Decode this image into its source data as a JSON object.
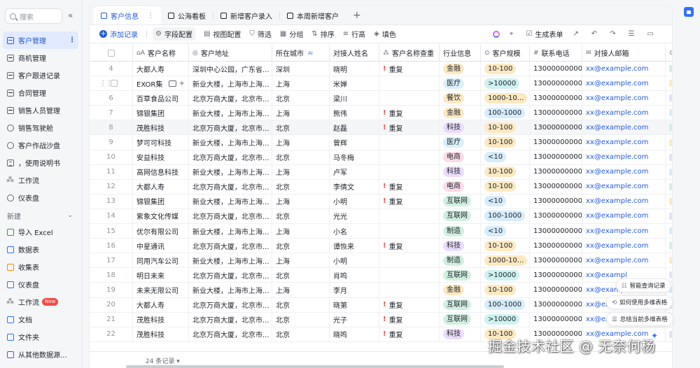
{
  "sidebar": {
    "search_placeholder": "搜索",
    "collapse_icon": "«",
    "items": [
      {
        "label": "客户管理",
        "icon": "grid",
        "active": true
      },
      {
        "label": "商机管理",
        "icon": "grid"
      },
      {
        "label": "客户跟进记录",
        "icon": "grid"
      },
      {
        "label": "合同管理",
        "icon": "grid"
      },
      {
        "label": "销售人员管理",
        "icon": "grid"
      },
      {
        "label": "销售驾驶舱",
        "icon": "gauge"
      },
      {
        "label": "客户作战沙盘",
        "icon": "gauge"
      },
      {
        "label": "，使用说明书",
        "icon": "doc"
      },
      {
        "label": "工作流",
        "icon": "flow"
      },
      {
        "label": "仪表盘",
        "icon": "gauge"
      }
    ],
    "section_title": "新建",
    "new_items": [
      {
        "label": "导入 Excel",
        "icon": "green"
      },
      {
        "label": "数据表",
        "icon": "blue"
      },
      {
        "label": "收集表",
        "icon": "orange"
      },
      {
        "label": "仪表盘",
        "icon": "blue"
      },
      {
        "label": "工作流",
        "icon": "flow",
        "badge": "New"
      },
      {
        "label": "文档",
        "icon": "blue"
      },
      {
        "label": "文件夹",
        "icon": "blue"
      },
      {
        "label": "从其他数据源...",
        "icon": "purple"
      }
    ]
  },
  "tabs": [
    {
      "label": "客户信息",
      "active": true,
      "more": "⋮"
    },
    {
      "label": "公海看板"
    },
    {
      "label": "新增客户录入"
    },
    {
      "label": "本周新增客户"
    }
  ],
  "tab_add": "+",
  "toolbar": {
    "add_record": "添加记录",
    "field_config": "字段配置",
    "view_config": "视图配置",
    "filter": "筛选",
    "group": "分组",
    "sort": "排序",
    "row_height": "行高",
    "fill": "填色",
    "generate_form": "生成表单"
  },
  "columns": {
    "name": "客户名称",
    "address": "客户地址",
    "city": "所在城市",
    "city_ai": "AI",
    "contact": "对接人姓名",
    "dup_check": "客户名称查重",
    "industry": "行业信息",
    "scale": "客户规模",
    "phone": "联系电话",
    "email": "对接人邮箱"
  },
  "hover_row_name": "EXOR集",
  "rows": [
    {
      "idx": "4",
      "name": "大都人寿",
      "addr": "深圳中心公园，广东省...",
      "city": "深圳",
      "contact": "晓明",
      "dup": "重复",
      "industry": "金融",
      "scale": "10-100",
      "phone": "13000000000",
      "email": "xx@example.com"
    },
    {
      "idx": "",
      "name": "EXOR集",
      "addr": "新业大楼，上海市上海...",
      "city": "上海",
      "contact": "米婵",
      "dup": "",
      "industry": "医疗",
      "scale": ">10000",
      "phone": "13000000000",
      "email": "xx@example.com"
    },
    {
      "idx": "6",
      "name": "百草食品公司",
      "addr": "北京万商大厦，北京市...",
      "city": "北京",
      "contact": "梁川",
      "dup": "",
      "industry": "餐饮",
      "scale": "1000-10...",
      "phone": "13000000000",
      "email": "xx@example.com"
    },
    {
      "idx": "7",
      "name": "锦银集团",
      "addr": "新业大楼，上海市上海...",
      "city": "上海",
      "contact": "熊伟",
      "dup": "重复",
      "industry": "金融",
      "scale": "100-1000",
      "phone": "13000000000",
      "email": "xx@example.com"
    },
    {
      "idx": "8",
      "name": "茂胜科技",
      "addr": "北京万商大厦，北京市...",
      "city": "北京",
      "contact": "赵磊",
      "dup": "重复",
      "industry": "科技",
      "scale": "10-100",
      "phone": "13000000000",
      "email": "xx@example.com"
    },
    {
      "idx": "9",
      "name": "梦可可科技",
      "addr": "新业大楼，上海市上海...",
      "city": "上海",
      "contact": "曾辉",
      "dup": "",
      "industry": "医疗",
      "scale": "10-100",
      "phone": "13000000000",
      "email": "xx@example.com"
    },
    {
      "idx": "10",
      "name": "安益科技",
      "addr": "北京万商大厦，北京市...",
      "city": "北京",
      "contact": "马冬梅",
      "dup": "",
      "industry": "电商",
      "scale": "<10",
      "phone": "13000000000",
      "email": "xx@example.com"
    },
    {
      "idx": "11",
      "name": "高网信息科技",
      "addr": "新业大楼，上海市上海...",
      "city": "上海",
      "contact": "卢军",
      "dup": "",
      "industry": "科技",
      "scale": "10-100",
      "phone": "13000000000",
      "email": "xx@example.com"
    },
    {
      "idx": "12",
      "name": "大都人寿",
      "addr": "北京万商大厦，北京市...",
      "city": "北京",
      "contact": "李倩文",
      "dup": "重复",
      "industry": "电商",
      "scale": "10-100",
      "phone": "13000000000",
      "email": "xx@example.com"
    },
    {
      "idx": "13",
      "name": "锦银集团",
      "addr": "新业大楼，上海市上海...",
      "city": "上海",
      "contact": "小明",
      "dup": "重复",
      "industry": "互联网",
      "scale": "<10",
      "phone": "13000000000",
      "email": "xx@example.com"
    },
    {
      "idx": "14",
      "name": "紫象文化传媒",
      "addr": "北京万商大厦，北京市...",
      "city": "北京",
      "contact": "光光",
      "dup": "",
      "industry": "互联网",
      "scale": "100-1000",
      "phone": "13000000000",
      "email": "xx@example.com"
    },
    {
      "idx": "15",
      "name": "优尔有限公司",
      "addr": "新业大楼，上海市上海...",
      "city": "上海",
      "contact": "小名",
      "dup": "",
      "industry": "制造",
      "scale": "<10",
      "phone": "13000000000",
      "email": "xx@example.com"
    },
    {
      "idx": "16",
      "name": "中星通讯",
      "addr": "北京万商大厦，北京市...",
      "city": "北京",
      "contact": "谭恢来",
      "dup": "重复",
      "industry": "科技",
      "scale": "10-100",
      "phone": "13000000000",
      "email": "xx@example.com"
    },
    {
      "idx": "17",
      "name": "同用汽车公司",
      "addr": "新业大楼，上海市上海...",
      "city": "上海",
      "contact": "小明",
      "dup": "",
      "industry": "制造",
      "scale": "1000-10...",
      "phone": "13000000000",
      "email": "xx@example.com"
    },
    {
      "idx": "18",
      "name": "明日未来",
      "addr": "北京万商大厦，北京市...",
      "city": "北京",
      "contact": "肖鸣",
      "dup": "",
      "industry": "互联网",
      "scale": ">10000",
      "phone": "13000000000",
      "email": "xx@exampl"
    },
    {
      "idx": "19",
      "name": "未来无限公司",
      "addr": "新业大楼，上海市上海...",
      "city": "上海",
      "contact": "李月",
      "dup": "",
      "industry": "金融",
      "scale": "10-100",
      "phone": "13000000000",
      "email": "xx@examp"
    },
    {
      "idx": "20",
      "name": "大都人寿",
      "addr": "北京万商大厦，北京市...",
      "city": "北京",
      "contact": "晓第",
      "dup": "重复",
      "industry": "互联网",
      "scale": "100-1000",
      "phone": "13000000000",
      "email": "xx@example"
    },
    {
      "idx": "21",
      "name": "茂胜科技",
      "addr": "北京万商大厦，北京市...",
      "city": "北京",
      "contact": "光子",
      "dup": "重复",
      "industry": "互联网",
      "scale": ">10000",
      "phone": "13000000000",
      "email": "xx@example.com"
    },
    {
      "idx": "22",
      "name": "茂胜科技",
      "addr": "北京万商大厦，北京市...",
      "city": "北京",
      "contact": "晓鸣",
      "dup": "重复",
      "industry": "科技",
      "scale": "10-100",
      "phone": "13000000000",
      "email": "xx@example.com"
    }
  ],
  "industry_colors": {
    "金融": {
      "bg": "#fde9c1",
      "fg": "#1f2329"
    },
    "医疗": {
      "bg": "#d8f0f9",
      "fg": "#1f2329"
    },
    "餐饮": {
      "bg": "#fde9c1",
      "fg": "#1f2329"
    },
    "科技": {
      "bg": "#eadcfb",
      "fg": "#1f2329"
    },
    "电商": {
      "bg": "#fbdbe7",
      "fg": "#1f2329"
    },
    "互联网": {
      "bg": "#d1efe0",
      "fg": "#1f2329"
    },
    "制造": {
      "bg": "#d1efe0",
      "fg": "#1f2329"
    }
  },
  "scale_colors": {
    "10-100": "#fde9c1",
    ">10000": "#cdf2ef",
    "1000-10...": "#fde9c1",
    "100-1000": "#d6ecfb",
    "<10": "#d6ecfb"
  },
  "footer": {
    "record_count": "24 条记录"
  },
  "hints": [
    {
      "label": "智能查询记录"
    },
    {
      "label": "如何使用多维表格"
    },
    {
      "label": "总结当前多维表格"
    }
  ],
  "watermark": "掘金技术社区 @ 无奈何杨",
  "colors": {
    "accent": "#245bdb",
    "sidebar_active_bg": "#e1eaff",
    "dup_mark": "#f54a45"
  }
}
